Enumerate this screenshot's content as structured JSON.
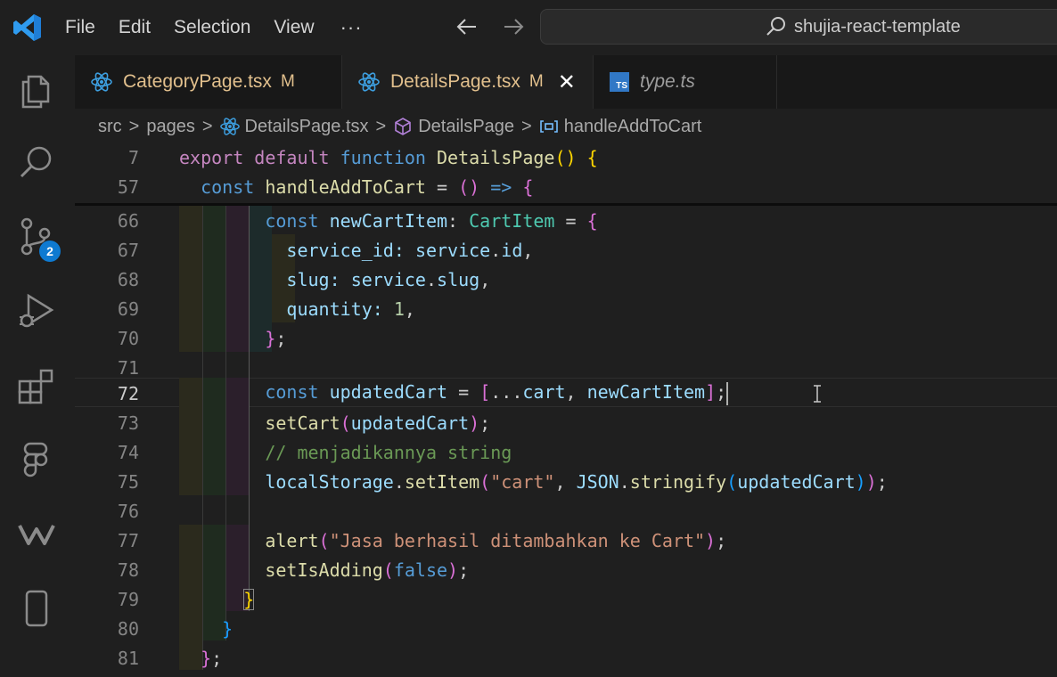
{
  "menu": {
    "file": "File",
    "edit": "Edit",
    "selection": "Selection",
    "view": "View",
    "more": "···"
  },
  "search": {
    "text": "shujia-react-template"
  },
  "activity": {
    "scm_badge": "2"
  },
  "tabs": [
    {
      "label": "CategoryPage.tsx",
      "status": "M"
    },
    {
      "label": "DetailsPage.tsx",
      "status": "M",
      "close": "✕"
    },
    {
      "label": "type.ts",
      "icon_text": "TS"
    }
  ],
  "breadcrumb": {
    "src": "src",
    "pages": "pages",
    "file": "DetailsPage.tsx",
    "component": "DetailsPage",
    "function": "handleAddToCart",
    "sep": ">"
  },
  "editor": {
    "lines": [
      {
        "num": "7"
      },
      {
        "num": "57"
      },
      {
        "num": "66"
      },
      {
        "num": "67"
      },
      {
        "num": "68"
      },
      {
        "num": "69"
      },
      {
        "num": "70"
      },
      {
        "num": "71"
      },
      {
        "num": "72"
      },
      {
        "num": "73"
      },
      {
        "num": "74"
      },
      {
        "num": "75"
      },
      {
        "num": "76"
      },
      {
        "num": "77"
      },
      {
        "num": "78"
      },
      {
        "num": "79"
      },
      {
        "num": "80"
      },
      {
        "num": "81"
      }
    ],
    "tokens": {
      "l7": [
        "export",
        "default",
        "function",
        "DetailsPage",
        "(",
        ")",
        "{"
      ],
      "l57": [
        "const",
        "handleAddToCart",
        "=",
        "(",
        ")",
        "=>",
        "{"
      ],
      "l66": [
        "const",
        "newCartItem",
        ":",
        "CartItem",
        "=",
        "{"
      ],
      "l67": [
        "service_id",
        ":",
        "service",
        ".",
        "id",
        ","
      ],
      "l68": [
        "slug",
        ":",
        "service",
        ".",
        "slug",
        ","
      ],
      "l69": [
        "quantity",
        ":",
        "1",
        ","
      ],
      "l70": [
        "}",
        ";"
      ],
      "l72": [
        "const",
        "updatedCart",
        "=",
        "[",
        "...",
        "cart",
        ",",
        "newCartItem",
        "]",
        ";"
      ],
      "l73": [
        "setCart",
        "(",
        "updatedCart",
        ")",
        ";"
      ],
      "l74": [
        "// menjadikannya string"
      ],
      "l75": [
        "localStorage",
        ".",
        "setItem",
        "(",
        "\"cart\"",
        ",",
        "JSON",
        ".",
        "stringify",
        "(",
        "updatedCart",
        ")",
        ")",
        ";"
      ],
      "l77": [
        "alert",
        "(",
        "\"Jasa berhasil ditambahkan ke Cart\"",
        ")",
        ";"
      ],
      "l78": [
        "setIsAdding",
        "(",
        "false",
        ")",
        ";"
      ],
      "l79": [
        "}"
      ],
      "l80": [
        "}"
      ],
      "l81": [
        "}",
        ";"
      ]
    }
  },
  "colors": {
    "keyword": "#c586c0",
    "storage": "#569cd6",
    "function": "#dcdcaa",
    "variable": "#9cdcfe",
    "type": "#4ec9b0",
    "string": "#ce9178",
    "number": "#b5cea8",
    "comment": "#6a9955",
    "accent": "#0e7ad1"
  }
}
